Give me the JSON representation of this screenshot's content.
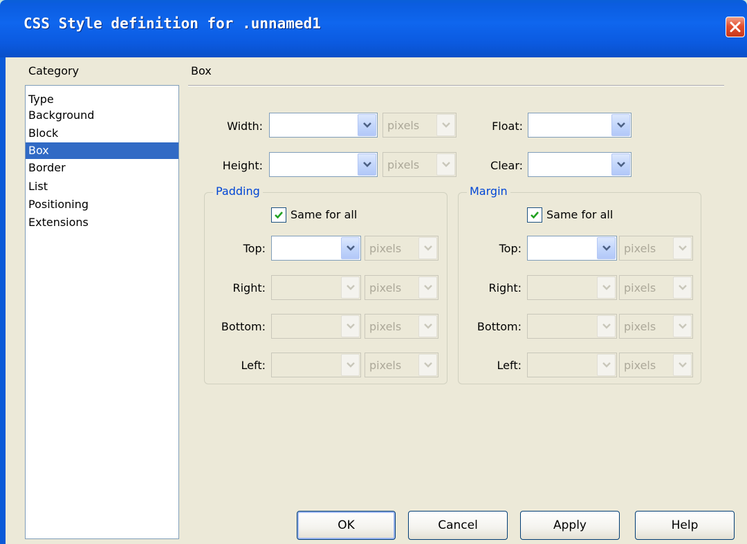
{
  "window": {
    "title": "CSS Style definition for .unnamed1"
  },
  "category": {
    "label": "Category",
    "items": [
      "Type",
      "Background",
      "Block",
      "Box",
      "Border",
      "List",
      "Positioning",
      "Extensions"
    ],
    "selected": "Box"
  },
  "panel": {
    "heading": "Box"
  },
  "size": {
    "width_label": "Width:",
    "height_label": "Height:",
    "width_value": "",
    "height_value": "",
    "width_unit": "pixels",
    "height_unit": "pixels"
  },
  "float": {
    "float_label": "Float:",
    "float_value": "",
    "clear_label": "Clear:",
    "clear_value": ""
  },
  "padding": {
    "title": "Padding",
    "same_label": "Same for all",
    "same_checked": true,
    "top_label": "Top:",
    "right_label": "Right:",
    "bottom_label": "Bottom:",
    "left_label": "Left:",
    "top_unit": "pixels",
    "right_unit": "pixels",
    "bottom_unit": "pixels",
    "left_unit": "pixels"
  },
  "margin": {
    "title": "Margin",
    "same_label": "Same for all",
    "same_checked": true,
    "top_label": "Top:",
    "right_label": "Right:",
    "bottom_label": "Bottom:",
    "left_label": "Left:",
    "top_unit": "pixels",
    "right_unit": "pixels",
    "bottom_unit": "pixels",
    "left_unit": "pixels"
  },
  "buttons": {
    "ok": "OK",
    "cancel": "Cancel",
    "apply": "Apply",
    "help": "Help"
  },
  "colors": {
    "titlebar": "#0b5de0",
    "selection": "#316ac5",
    "group_title": "#0046d5",
    "dialog_bg": "#ece9d8"
  },
  "icons": {
    "close": "close-icon",
    "dropdown": "chevron-down-icon",
    "check": "checkmark-icon"
  }
}
